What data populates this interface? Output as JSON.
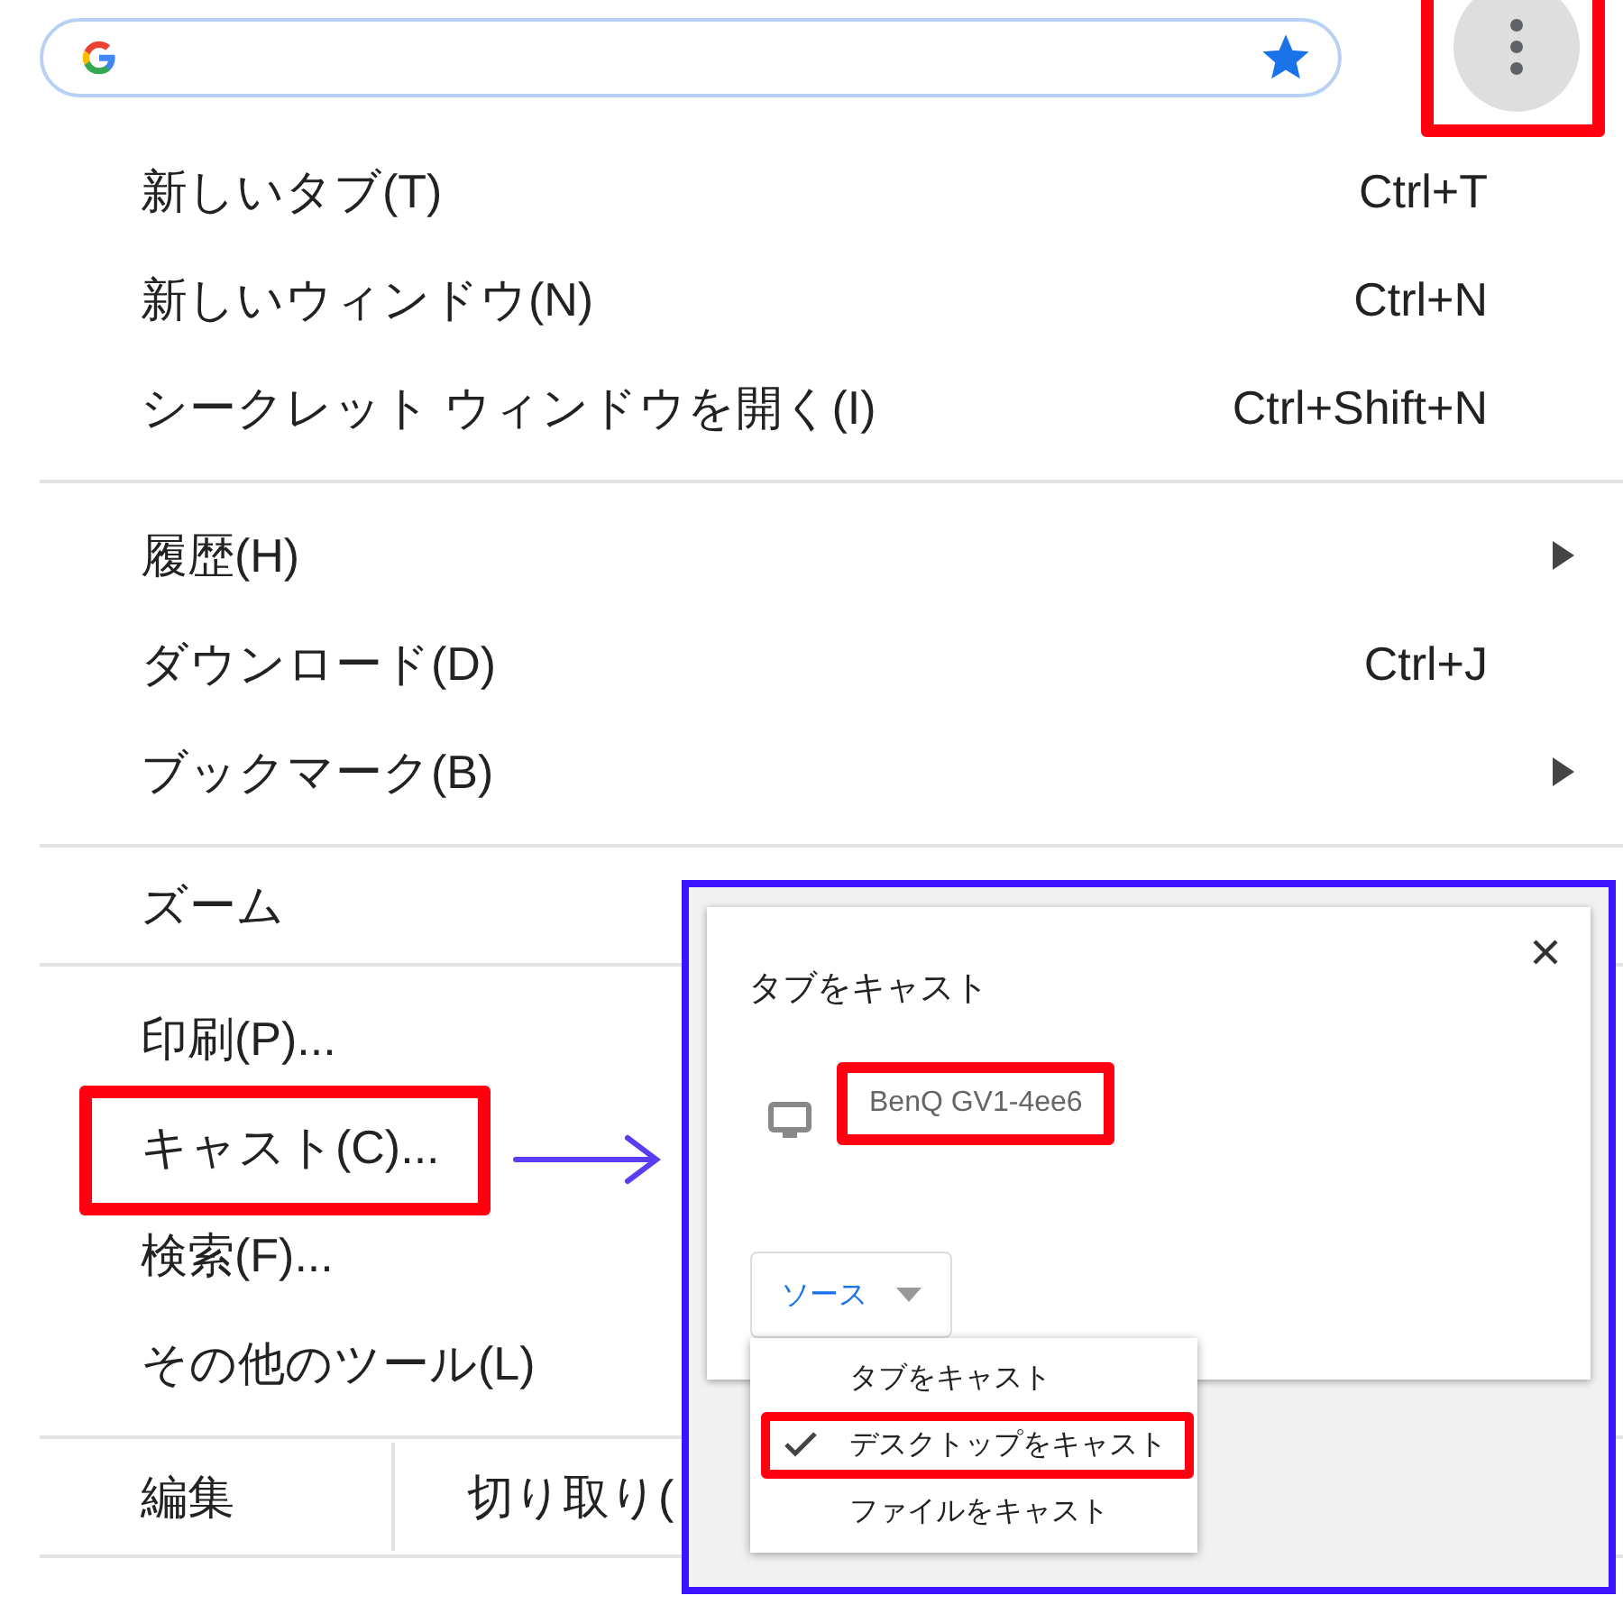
{
  "address_bar": {
    "bookmarked": true
  },
  "menu_button": {
    "outlined": true
  },
  "menu": {
    "sections": [
      {
        "items": [
          {
            "kind": "command",
            "label": "新しいタブ(T)",
            "shortcut": "Ctrl+T",
            "outlined": false
          },
          {
            "kind": "command",
            "label": "新しいウィンドウ(N)",
            "shortcut": "Ctrl+N",
            "outlined": false
          },
          {
            "kind": "command",
            "label": "シークレット ウィンドウを開く(I)",
            "shortcut": "Ctrl+Shift+N",
            "outlined": false
          }
        ]
      },
      {
        "items": [
          {
            "kind": "submenu",
            "label": "履歴(H)",
            "outlined": false
          },
          {
            "kind": "command",
            "label": "ダウンロード(D)",
            "shortcut": "Ctrl+J",
            "outlined": false
          },
          {
            "kind": "submenu",
            "label": "ブックマーク(B)",
            "outlined": false
          }
        ]
      },
      {
        "items": [
          {
            "kind": "zoom",
            "label": "ズーム",
            "outlined": false
          }
        ]
      },
      {
        "items": [
          {
            "kind": "command",
            "label": "印刷(P)...",
            "outlined": false
          },
          {
            "kind": "command",
            "label": "キャスト(C)...",
            "outlined": true
          },
          {
            "kind": "command",
            "label": "検索(F)...",
            "outlined": false
          },
          {
            "kind": "command",
            "label": "その他のツール(L)",
            "outlined": false
          }
        ]
      },
      {
        "items": [
          {
            "kind": "edit",
            "label": "編集",
            "actions": [
              "切り取り("
            ],
            "outlined": false
          }
        ]
      }
    ]
  },
  "annotation_arrow": true,
  "cast_dialog": {
    "title": "タブをキャスト",
    "devices": [
      {
        "name": "BenQ GV1-4ee6",
        "outlined": true
      }
    ],
    "source_button": {
      "label": "ソース"
    },
    "source_menu": [
      {
        "label": "タブをキャスト",
        "selected": false,
        "outlined": false
      },
      {
        "label": "デスクトップをキャスト",
        "selected": true,
        "outlined": true
      },
      {
        "label": "ファイルをキャスト",
        "selected": false,
        "outlined": false
      }
    ]
  }
}
